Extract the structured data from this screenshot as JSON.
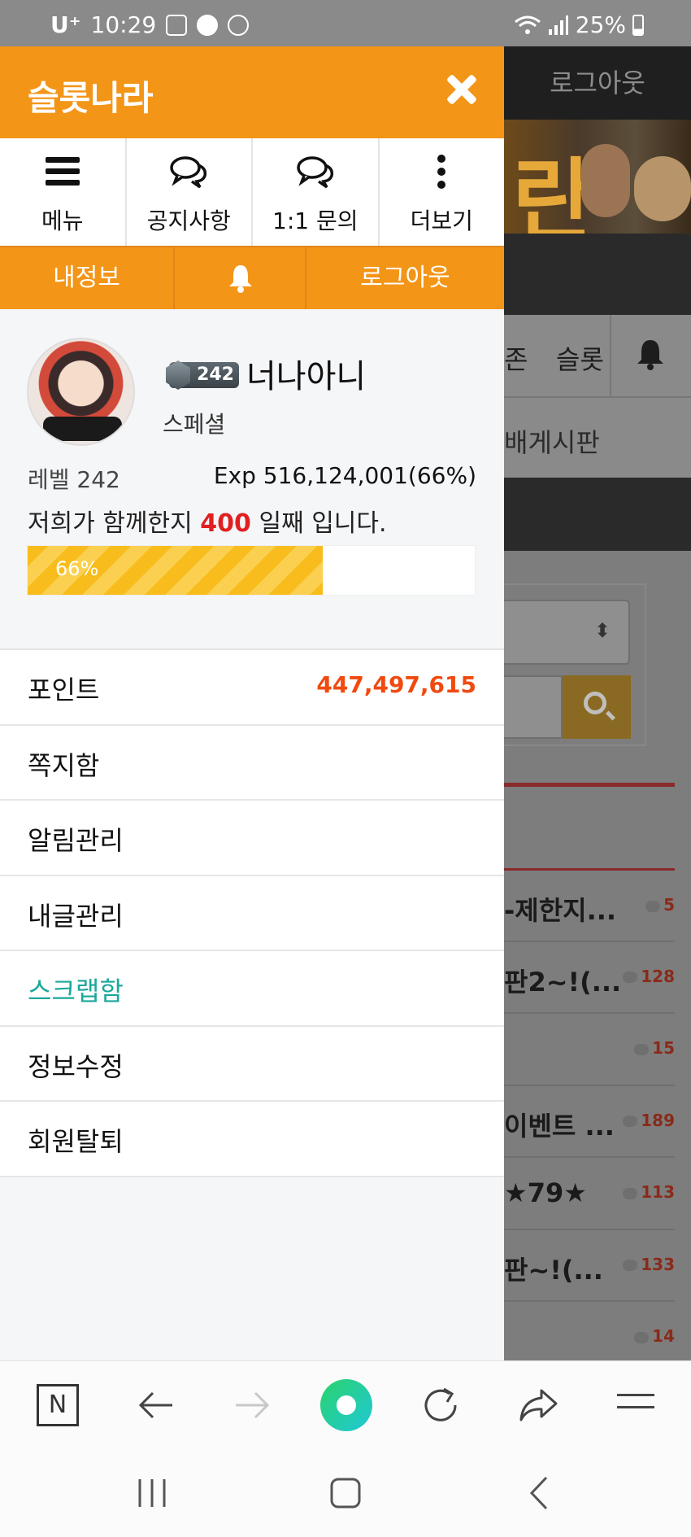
{
  "status_bar": {
    "carrier": "U⁺",
    "time": "10:29",
    "battery": "25%",
    "icons": [
      "gallery-icon",
      "kakaotalk-icon",
      "alarm-icon",
      "wifi-icon",
      "signal-icon",
      "battery-icon"
    ]
  },
  "background_page": {
    "logout": "로그아웃",
    "banner_text": "란",
    "nav_items": [
      "존",
      "슬롯"
    ],
    "sub_title": "배게시판",
    "posts": [
      {
        "title": "-제한지...",
        "count": "5"
      },
      {
        "title": "판2~!(...",
        "count": "128"
      },
      {
        "title": "",
        "count": "15"
      },
      {
        "title": "이벤트 ...",
        "count": "189"
      },
      {
        "title": "★79★",
        "count": "113"
      },
      {
        "title": "판~!(...",
        "count": "133"
      },
      {
        "title": "",
        "count": "14"
      }
    ]
  },
  "drawer": {
    "title": "슬롯나라",
    "quick_nav": [
      {
        "label": "메뉴",
        "icon": "hamburger-menu-icon"
      },
      {
        "label": "공지사항",
        "icon": "chat-bubbles-icon"
      },
      {
        "label": "1:1 문의",
        "icon": "chat-bubbles-icon"
      },
      {
        "label": "더보기",
        "icon": "more-vertical-icon"
      }
    ],
    "action_bar": {
      "my_info": "내정보",
      "logout": "로그아웃"
    },
    "profile": {
      "level_badge": "242",
      "nickname": "너나아니",
      "grade": "스페셜",
      "level": "레벨 242",
      "exp": "Exp 516,124,001(66%)",
      "days_prefix": "저희가 함께한지",
      "days_value": "400",
      "days_suffix": "일째 입니다.",
      "progress_label": "66%",
      "progress_percent": 66
    },
    "menu": [
      {
        "label": "포인트",
        "value": "447,497,615"
      },
      {
        "label": "쪽지함"
      },
      {
        "label": "알림관리"
      },
      {
        "label": "내글관리"
      },
      {
        "label": "스크랩함",
        "active": true
      },
      {
        "label": "정보수정"
      },
      {
        "label": "회원탈퇴"
      }
    ]
  },
  "colors": {
    "accent_orange": "#f39517",
    "points_red": "#f04a10",
    "active_teal": "#1aa89a",
    "days_red": "#e02020",
    "progress_yellow": "#f8bd1c"
  }
}
